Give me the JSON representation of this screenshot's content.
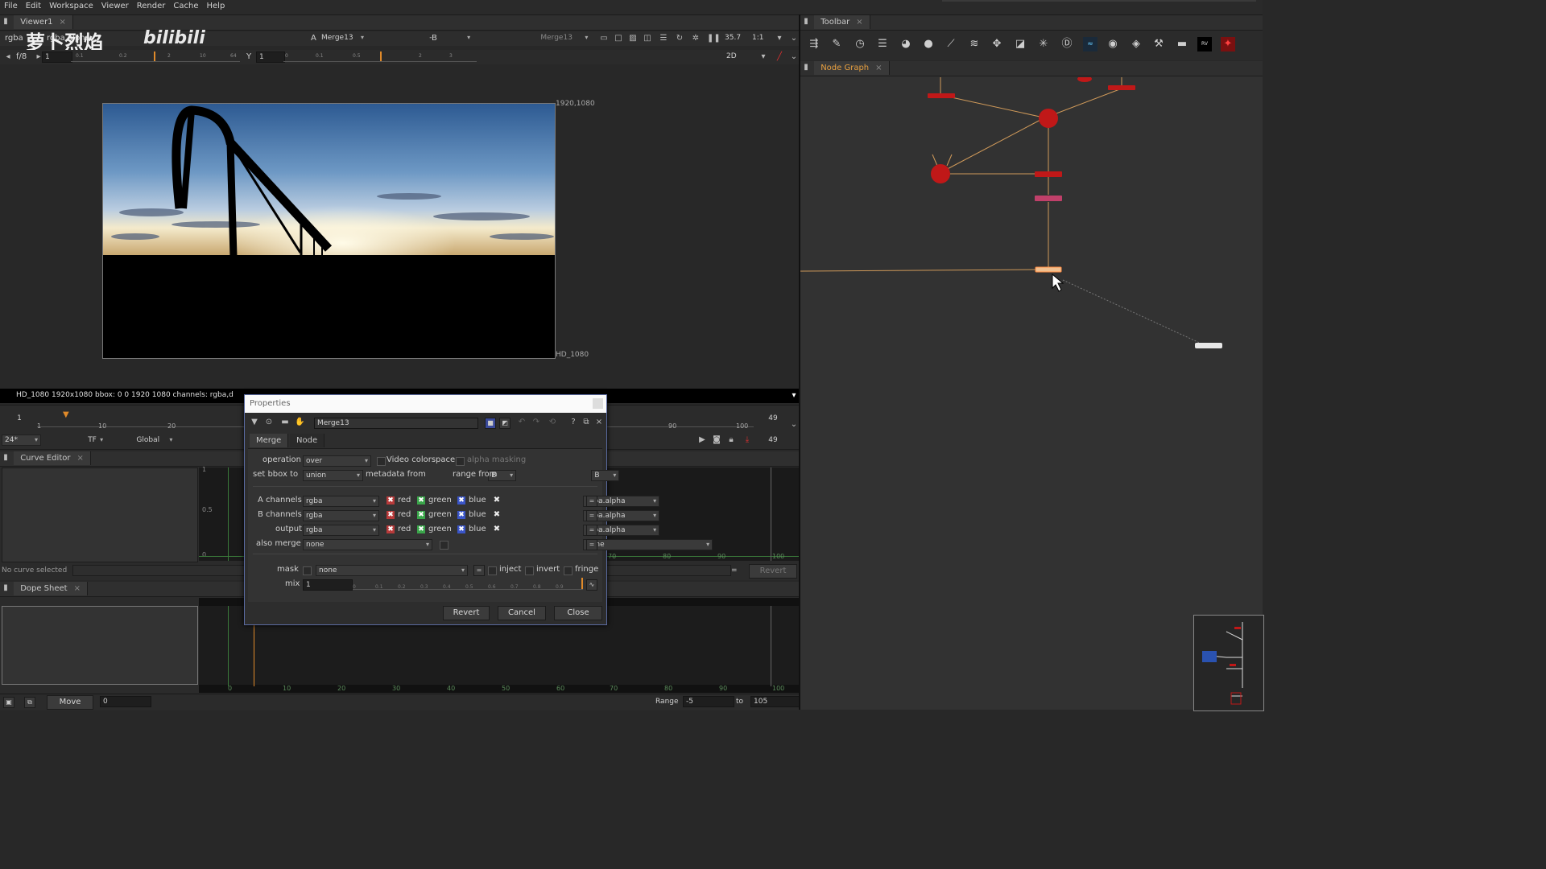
{
  "menubar": {
    "items": [
      "File",
      "Edit",
      "Workspace",
      "Viewer",
      "Render",
      "Cache",
      "Help"
    ]
  },
  "watermark": {
    "text": "萝卜烈焰"
  },
  "viewer": {
    "tab_label": "Viewer1",
    "channels": "rgba",
    "alpha_channel": "rgba.alpha",
    "gain_label": "f/8",
    "frame": "1",
    "gamma_label": "Y",
    "gamma_value": "1",
    "input_a_label": "A",
    "input_a_value": "Merge13",
    "composite_value": "-",
    "input_b_label": "B",
    "input_b_value": "Merge13",
    "zoom": "35.7",
    "proxy": "1:1",
    "view_mode": "2D",
    "format_size": "1920,1080",
    "format_name": "HD_1080",
    "status_text": "HD_1080 1920x1080  bbox: 0 0 1920 1080 channels: rgba,d",
    "gain_ticks": [
      "1",
      "0.1",
      "0.2",
      "1",
      "2",
      "10",
      "20",
      "64"
    ],
    "gamma_ticks": [
      "0",
      "0.1",
      "0.5",
      "1",
      "2",
      "3"
    ]
  },
  "timeline": {
    "start": "1",
    "end": "49",
    "end2": "49",
    "fps": "24*",
    "tf": "TF",
    "scope": "Global",
    "ticks": [
      "1",
      "10",
      "20",
      "90",
      "100"
    ]
  },
  "curve_editor": {
    "tab_label": "Curve Editor",
    "status": "No curve selected",
    "revert_label": "Revert",
    "equals": "=",
    "y_ticks": [
      "1",
      "0.5",
      "0"
    ],
    "x_ticks": [
      "70",
      "80",
      "90",
      "100"
    ]
  },
  "dope_sheet": {
    "tab_label": "Dope Sheet",
    "ticks": [
      "0",
      "10",
      "20",
      "30",
      "40",
      "50",
      "60",
      "70",
      "80",
      "90",
      "100"
    ],
    "move_label": "Move",
    "move_value": "0",
    "range_label": "Range",
    "range_from": "-5",
    "range_to_label": "to",
    "range_to": "105"
  },
  "toolbar_panel": {
    "tab_label": "Toolbar"
  },
  "node_graph": {
    "tab_label": "Node Graph"
  },
  "properties": {
    "title": "Properties",
    "node_name": "Merge13",
    "tabs": [
      "Merge",
      "Node"
    ],
    "operation_label": "operation",
    "operation_value": "over",
    "video_colorspace_label": "Video colorspace",
    "alpha_masking_label": "alpha masking",
    "bbox_label": "set bbox to",
    "bbox_value": "union",
    "metadata_label": "metadata from",
    "metadata_value": "B",
    "range_label": "range from",
    "range_value": "B",
    "channel_rows": [
      {
        "label": "A channels",
        "value": "rgba",
        "alpha": "rgba.alpha"
      },
      {
        "label": "B channels",
        "value": "rgba",
        "alpha": "rgba.alpha"
      },
      {
        "label": "output",
        "value": "rgba",
        "alpha": "rgba.alpha"
      }
    ],
    "red_label": "red",
    "green_label": "green",
    "blue_label": "blue",
    "also_merge_label": "also merge",
    "also_merge_value": "none",
    "also_merge_value2": "none",
    "mask_label": "mask",
    "mask_value": "none",
    "inject_label": "inject",
    "invert_label": "invert",
    "fringe_label": "fringe",
    "mix_label": "mix",
    "mix_value": "1",
    "mix_ticks": [
      "0",
      "0.1",
      "0.2",
      "0.3",
      "0.4",
      "0.5",
      "0.6",
      "0.7",
      "0.8",
      "0.9",
      "1"
    ],
    "revert_label": "Revert",
    "cancel_label": "Cancel",
    "close_label": "Close"
  }
}
